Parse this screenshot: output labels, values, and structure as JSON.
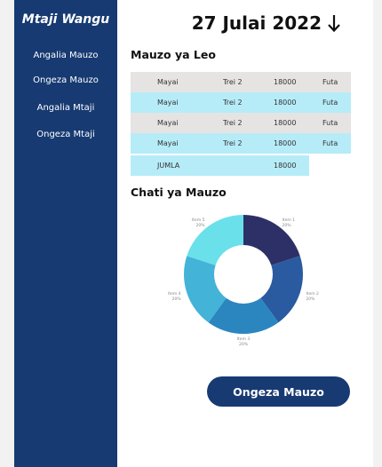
{
  "sidebar": {
    "brand": "Mtaji Wangu",
    "items": [
      {
        "label": "Angalia Mauzo"
      },
      {
        "label": "Ongeza Mauzo"
      },
      {
        "label": "Angalia Mtaji"
      },
      {
        "label": "Ongeza Mtaji"
      }
    ]
  },
  "header": {
    "date": "27 Julai 2022"
  },
  "sales": {
    "title": "Mauzo ya Leo",
    "rows": [
      {
        "product": "Mayai",
        "quantity": "Trei 2",
        "amount": "18000",
        "status": "Futa"
      },
      {
        "product": "Mayai",
        "quantity": "Trei 2",
        "amount": "18000",
        "status": "Futa"
      },
      {
        "product": "Mayai",
        "quantity": "Trei 2",
        "amount": "18000",
        "status": "Futa"
      },
      {
        "product": "Mayai",
        "quantity": "Trei 2",
        "amount": "18000",
        "status": "Futa"
      }
    ],
    "total": {
      "label": "JUMLA",
      "value": "18000"
    }
  },
  "chart_section": {
    "title": "Chati ya Mauzo"
  },
  "chart_data": {
    "type": "pie",
    "donut": true,
    "categories": [
      "Item 1",
      "Item 2",
      "Item 3",
      "Item 4",
      "Item 5"
    ],
    "values": [
      20,
      20,
      20,
      20,
      20
    ],
    "value_labels": [
      "20%",
      "20%",
      "20%",
      "20%",
      "20%"
    ],
    "colors": [
      "#2d3066",
      "#2a5aa0",
      "#2b86c0",
      "#43b3d8",
      "#6ae0ea"
    ],
    "legend": "none"
  },
  "cta": {
    "label": "Ongeza Mauzo"
  }
}
